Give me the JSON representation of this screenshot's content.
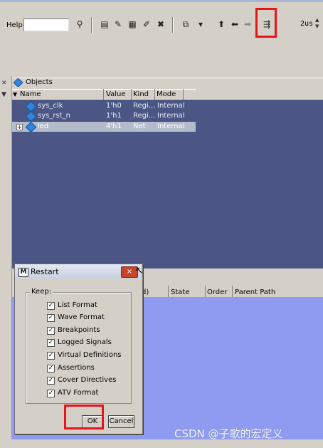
{
  "toolbar": {
    "help_label": "Help",
    "help_value": "",
    "time_value": "2us",
    "icons": [
      "search-icon",
      "save-icon",
      "edit-icon",
      "table-icon",
      "log-icon",
      "delete-icon",
      "restart-icon",
      "dropdown-icon",
      "up-arrow-icon",
      "left-arrow-icon",
      "right-arrow-icon",
      "run-icon"
    ]
  },
  "objects": {
    "title": "Objects",
    "columns": [
      "Name",
      "Value",
      "Kind",
      "Mode"
    ],
    "rows": [
      {
        "name": "sys_clk",
        "value": "1'h0",
        "kind": "Regi...",
        "mode": "Internal",
        "expandable": false
      },
      {
        "name": "sys_rst_n",
        "value": "1'h1",
        "kind": "Regi...",
        "mode": "Internal",
        "expandable": false
      },
      {
        "name": "led",
        "value": "4'h1",
        "kind": "Net",
        "mode": "Internal",
        "expandable": true
      }
    ]
  },
  "lower_pane": {
    "columns": [
      "d)",
      "State",
      "Order",
      "Parent Path"
    ]
  },
  "dialog": {
    "title": "Restart",
    "close_label": "×",
    "keep_label": "Keep:",
    "options": [
      {
        "label": "List Format",
        "checked": true
      },
      {
        "label": "Wave Format",
        "checked": true
      },
      {
        "label": "Breakpoints",
        "checked": true
      },
      {
        "label": "Logged Signals",
        "checked": true
      },
      {
        "label": "Virtual Definitions",
        "checked": true
      },
      {
        "label": "Assertions",
        "checked": true
      },
      {
        "label": "Cover Directives",
        "checked": true
      },
      {
        "label": "ATV Format",
        "checked": true
      }
    ],
    "ok_label": "OK",
    "cancel_label": "Cancel"
  },
  "watermark": "CSDN @子歌的宏定义",
  "colors": {
    "highlight": "#e8141c",
    "objects_bg": "#4c5685",
    "lower_bg": "#8e9bf0"
  }
}
